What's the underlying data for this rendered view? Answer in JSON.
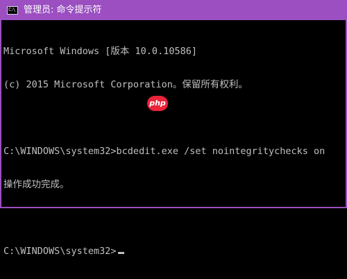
{
  "window": {
    "title": "管理员: 命令提示符",
    "icon_text": "C:\\",
    "icon": "cmd-icon"
  },
  "console": {
    "lines": [
      "Microsoft Windows [版本 10.0.10586]",
      "(c) 2015 Microsoft Corporation。保留所有权利。",
      "",
      "C:\\WINDOWS\\system32>bcdedit.exe /set nointegritychecks on",
      "操作成功完成。",
      "",
      "C:\\WINDOWS\\system32>"
    ]
  },
  "watermark": {
    "text": "php"
  },
  "colors": {
    "titlebar": "#9b4fc1",
    "console_bg": "#000000",
    "console_text": "#c0c0c0",
    "watermark_bg": "#e8233a"
  }
}
